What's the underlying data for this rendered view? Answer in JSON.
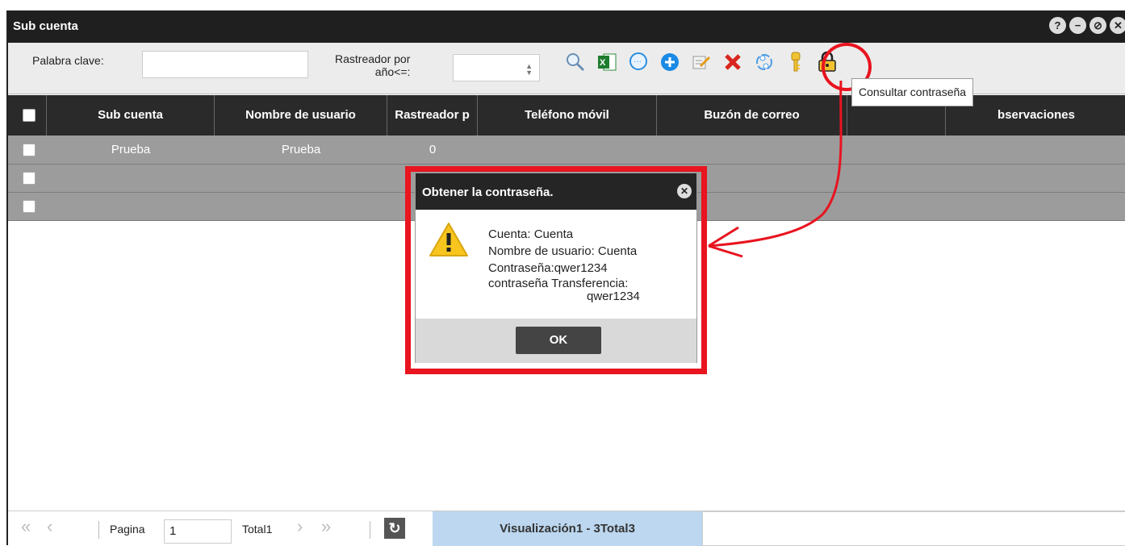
{
  "window": {
    "title": "Sub cuenta",
    "controls": [
      "?",
      "−",
      "⊘",
      "✕"
    ]
  },
  "toolbar": {
    "keyword_label": "Palabra clave:",
    "keyword_value": "",
    "tracker_label_line1": "Rastreador por",
    "tracker_label_line2": "año<=:",
    "tracker_value": "",
    "icons": [
      "search-icon",
      "excel-export-icon",
      "message-icon",
      "add-icon",
      "edit-icon",
      "delete-icon",
      "refresh-sync-icon",
      "key-icon",
      "lock-icon"
    ]
  },
  "tooltip": "Consultar contraseña",
  "grid": {
    "columns": [
      "Sub cuenta",
      "Nombre de usuario",
      "Rastreador p",
      "Teléfono móvil",
      "Buzón de correo",
      "",
      "bservaciones"
    ],
    "rows": [
      {
        "sub_cuenta": "Prueba",
        "usuario": "Prueba",
        "rastreador": "0"
      },
      {
        "sub_cuenta": "",
        "usuario": "",
        "rastreador": ""
      },
      {
        "sub_cuenta": "",
        "usuario": "",
        "rastreador": ""
      }
    ]
  },
  "pager": {
    "page_label": "Pagina",
    "page_value": "1",
    "total": "Total1",
    "display": "Visualización1 - 3Total3"
  },
  "dialog": {
    "title": "Obtener la contraseña.",
    "line1": "Cuenta:  Cuenta",
    "line2": "Nombre de usuario: Cuenta",
    "line3": "Contraseña:qwer1234",
    "line4": "contraseña Transferencia:",
    "line5": "qwer1234",
    "ok": "OK"
  },
  "colors": {
    "highlight_red": "#e8141f",
    "title_bar": "#1f1f1f",
    "row_gray": "#9c9c9c",
    "pager_highlight": "#bcd7ef"
  }
}
